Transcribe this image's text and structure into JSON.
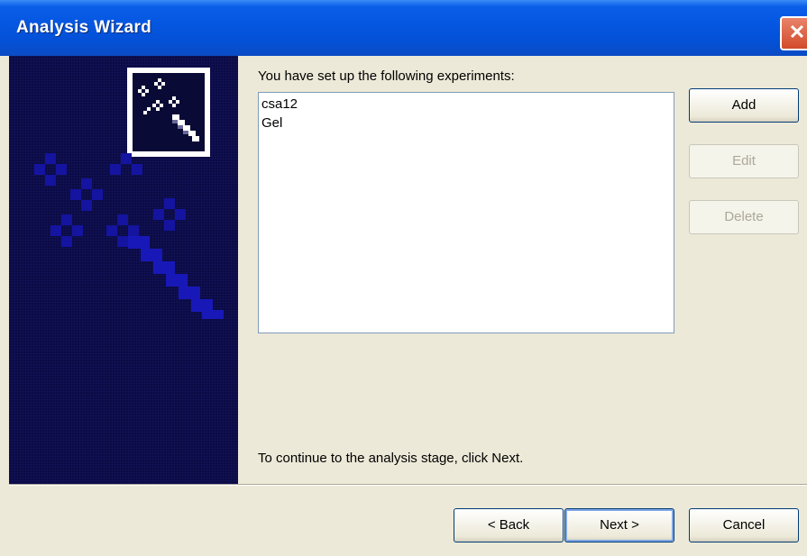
{
  "window": {
    "title": "Analysis Wizard",
    "close_glyph": "✕"
  },
  "main": {
    "prompt": "You have set up the following experiments:",
    "experiments": [
      "csa12",
      "Gel"
    ],
    "continue_text": "To continue to the analysis stage, click Next."
  },
  "side_buttons": {
    "add": "Add",
    "edit": "Edit",
    "delete": "Delete"
  },
  "footer_buttons": {
    "back": "< Back",
    "next": "Next >",
    "cancel": "Cancel"
  },
  "icons": {
    "wizard": "magic-wand-icon",
    "close": "close-icon"
  },
  "colors": {
    "titlebar": "#0556e0",
    "side_panel": "#0a0a44",
    "dialog_bg": "#ece9d8"
  }
}
